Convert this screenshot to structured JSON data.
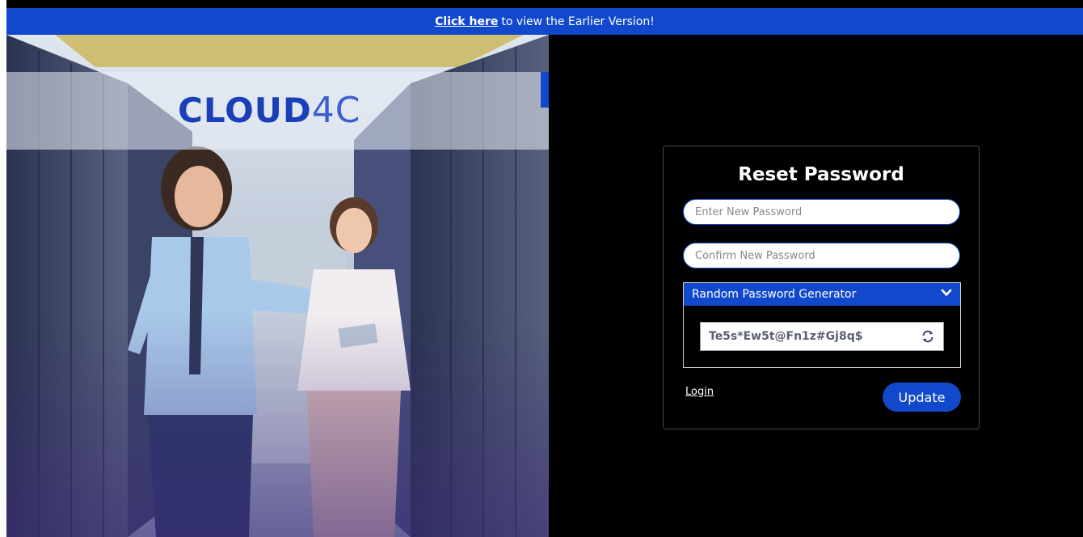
{
  "banner": {
    "link_text": "Click here",
    "text": "to view the Earlier Version!"
  },
  "brand": {
    "bold": "CLOUD",
    "light": "4C"
  },
  "reset_form": {
    "title": "Reset Password",
    "new_password_placeholder": "Enter New Password",
    "confirm_password_placeholder": "Confirm New Password",
    "generator_label": "Random Password Generator",
    "generated_password": "Te5s*Ew5t@Fn1z#Gj8q$",
    "login_label": "Login",
    "update_label": "Update"
  },
  "icons": {
    "generator_toggle": "chevron-down-icon",
    "regenerate": "refresh-icon"
  },
  "colors": {
    "accent": "#1249cc",
    "background": "#000000"
  }
}
